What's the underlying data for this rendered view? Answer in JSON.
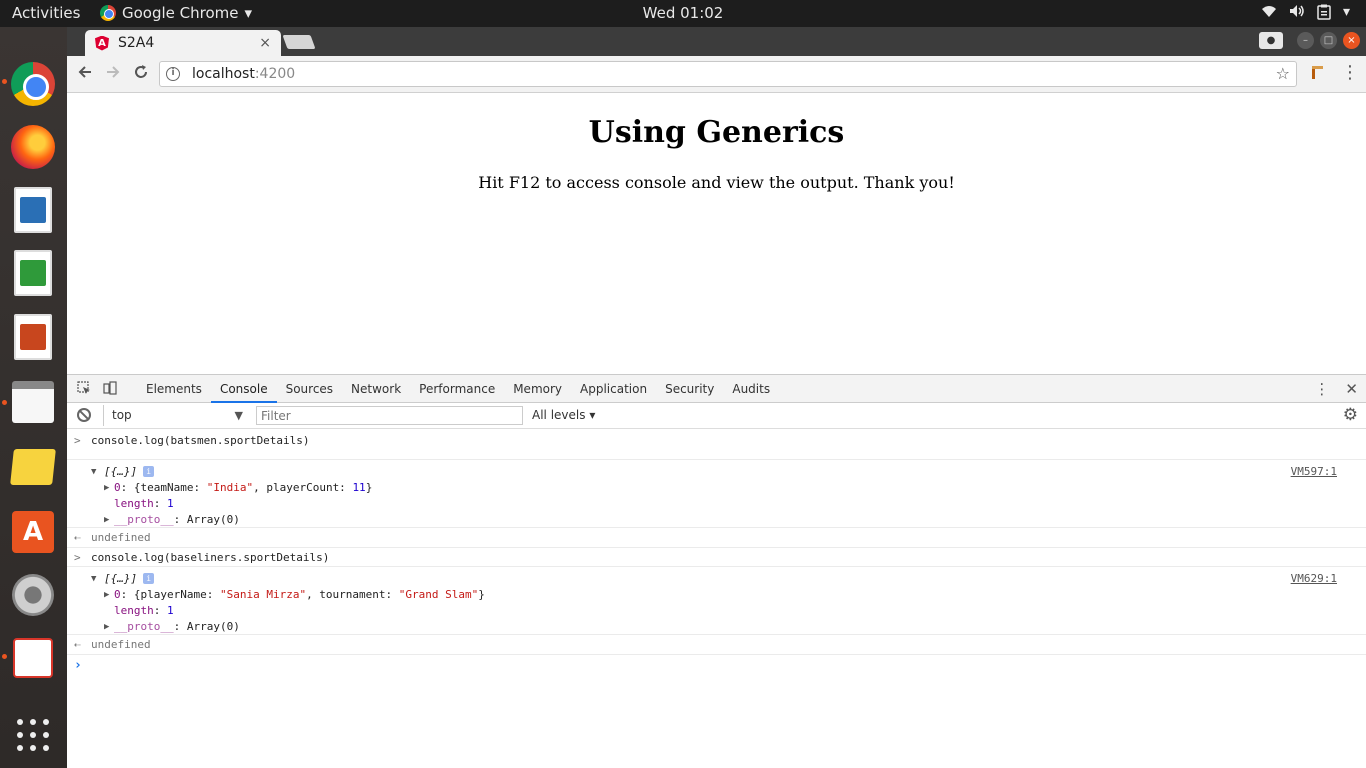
{
  "topbar": {
    "activities": "Activities",
    "app_name": "Google Chrome",
    "clock": "Wed 01:02"
  },
  "tab": {
    "title": "S2A4",
    "favicon_letter": "A",
    "close": "×"
  },
  "omnibox": {
    "host": "localhost",
    "port": ":4200"
  },
  "page": {
    "heading": "Using Generics",
    "text": "Hit F12 to access console and view the output. Thank you!"
  },
  "devtools": {
    "tabs": [
      "Elements",
      "Console",
      "Sources",
      "Network",
      "Performance",
      "Memory",
      "Application",
      "Security",
      "Audits"
    ],
    "active_tab": "Console",
    "context": "top",
    "filter_placeholder": "Filter",
    "levels": "All levels"
  },
  "console": {
    "cmd1": "console.log(batsmen.sportDetails)",
    "out1": {
      "summary": "[{…}]",
      "badge": "i",
      "item0_index": "0",
      "item0_open": "{teamName: ",
      "item0_val1": "\"India\"",
      "item0_mid": ", playerCount: ",
      "item0_val2": "11",
      "item0_close": "}",
      "length_key": "length",
      "length_val": "1",
      "proto_key": "__proto__",
      "proto_val": "Array(0)",
      "link": "VM597:1"
    },
    "ret1": "undefined",
    "cmd2": "console.log(baseliners.sportDetails)",
    "out2": {
      "summary": "[{…}]",
      "badge": "i",
      "item0_index": "0",
      "item0_open": "{playerName: ",
      "item0_val1": "\"Sania Mirza\"",
      "item0_mid": ", tournament: ",
      "item0_val2": "\"Grand Slam\"",
      "item0_close": "}",
      "length_key": "length",
      "length_val": "1",
      "proto_key": "__proto__",
      "proto_val": "Array(0)",
      "link": "VM629:1"
    },
    "ret2": "undefined"
  },
  "colors": {
    "ubuntu_orange": "#e95420",
    "devtools_active": "#1a73e8"
  }
}
